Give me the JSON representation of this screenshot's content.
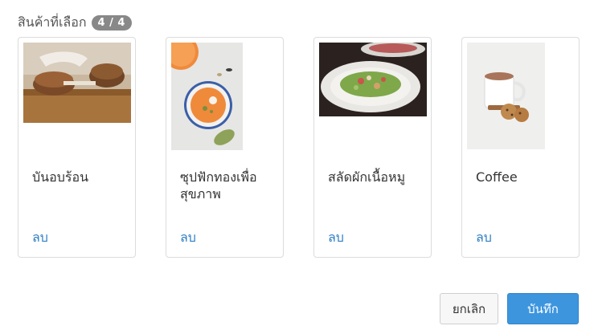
{
  "header": {
    "title": "สินค้าที่เลือก",
    "count": "4 / 4"
  },
  "products": [
    {
      "name": "บันอบร้อน",
      "remove_label": "ลบ"
    },
    {
      "name": "ซุปฟักทองเพื่อสุขภาพ",
      "remove_label": "ลบ"
    },
    {
      "name": "สลัดผักเนื้อหมู",
      "remove_label": "ลบ"
    },
    {
      "name": "Coffee",
      "remove_label": "ลบ"
    }
  ],
  "footer": {
    "cancel_label": "ยกเลิก",
    "save_label": "บันทึก"
  }
}
